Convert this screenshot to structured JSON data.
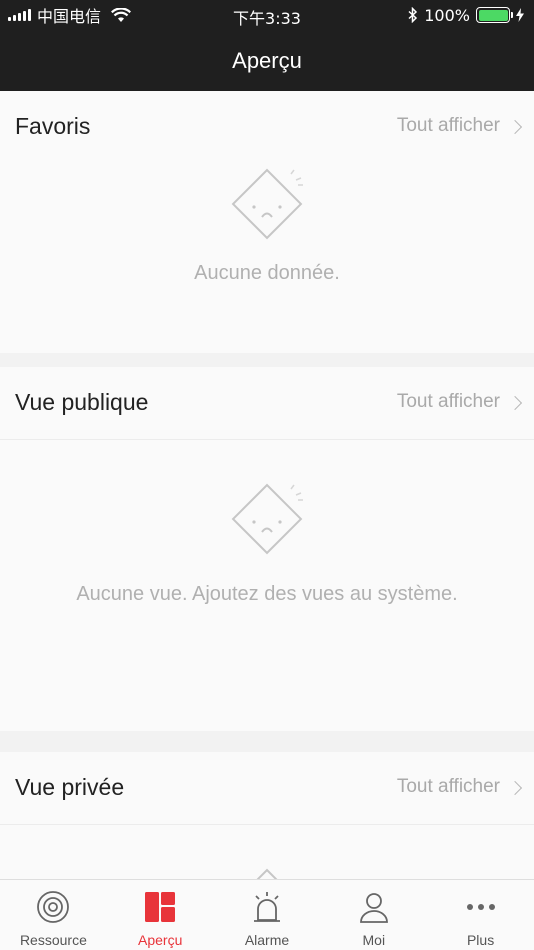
{
  "status_bar": {
    "carrier": "中国电信",
    "time": "下午3:33",
    "battery": "100%"
  },
  "header": {
    "title": "Aperçu"
  },
  "sections": [
    {
      "title": "Favoris",
      "see_all": "Tout afficher",
      "empty_text": "Aucune donnée."
    },
    {
      "title": "Vue publique",
      "see_all": "Tout afficher",
      "empty_text": "Aucune vue. Ajoutez des vues au système."
    },
    {
      "title": "Vue privée",
      "see_all": "Tout afficher",
      "empty_text": ""
    }
  ],
  "tabs": [
    {
      "label": "Ressource",
      "icon": "resource-icon",
      "active": false
    },
    {
      "label": "Aperçu",
      "icon": "overview-icon",
      "active": true
    },
    {
      "label": "Alarme",
      "icon": "alarm-icon",
      "active": false
    },
    {
      "label": "Moi",
      "icon": "user-icon",
      "active": false
    },
    {
      "label": "Plus",
      "icon": "more-icon",
      "active": false
    }
  ],
  "colors": {
    "header_bg": "#1f1f1f",
    "accent": "#e8343a",
    "battery": "#4cd964"
  }
}
